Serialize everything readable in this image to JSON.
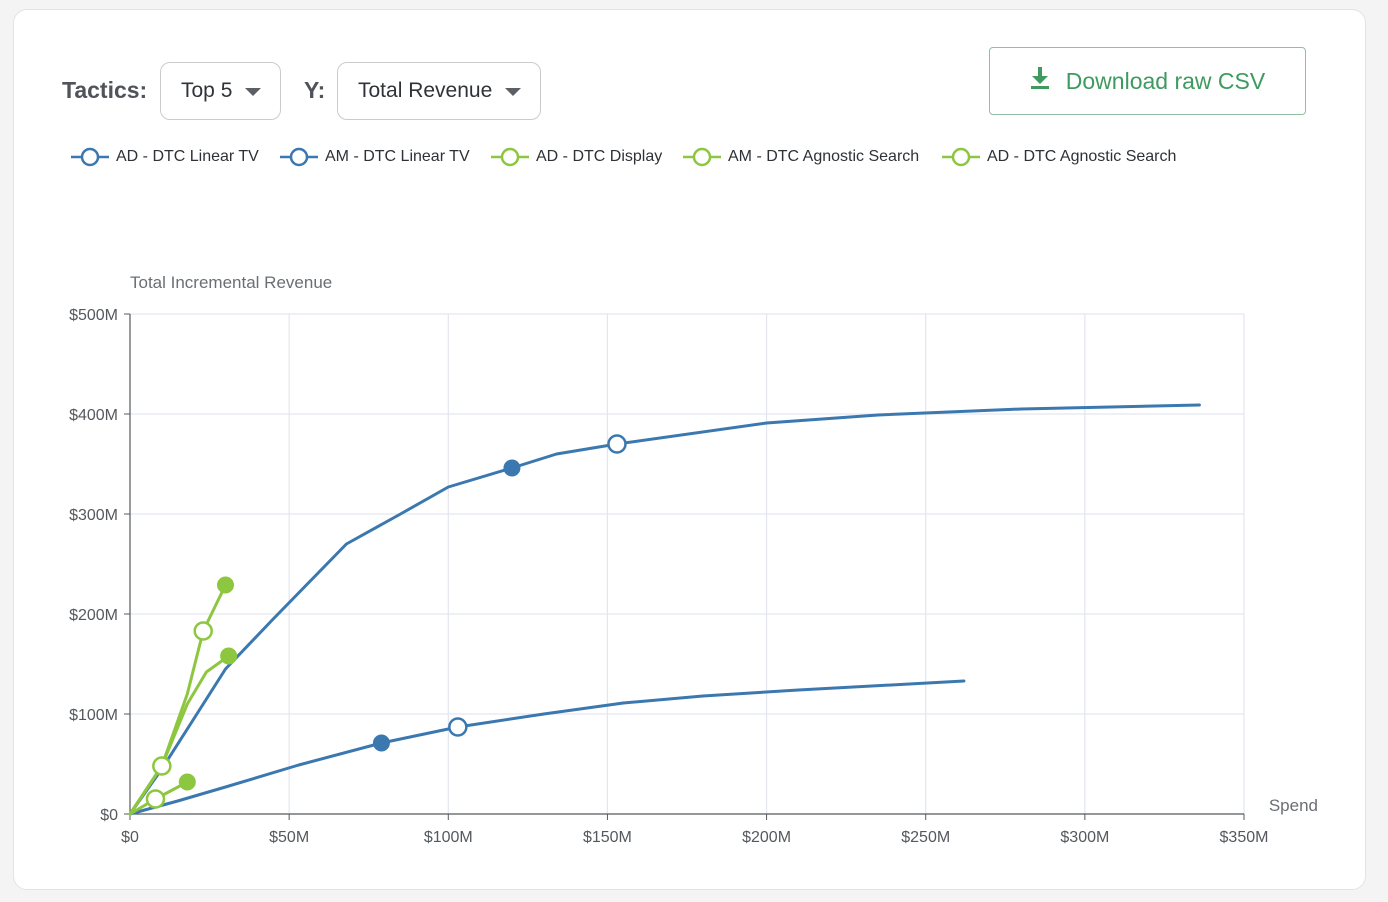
{
  "controls": {
    "tactics_label": "Tactics:",
    "tactics_value": "Top 5",
    "y_label": "Y:",
    "y_value": "Total Revenue",
    "download_label": "Download raw CSV"
  },
  "colors": {
    "blue": "#3b78b0",
    "green": "#8dc63f",
    "accent_green": "#3e9a5f"
  },
  "chart_data": {
    "type": "line",
    "ylabel": "Total Incremental Revenue",
    "xlabel": "Spend",
    "xlim": [
      0,
      350
    ],
    "ylim": [
      0,
      500
    ],
    "x_ticks": [
      "$0",
      "$50M",
      "$100M",
      "$150M",
      "$200M",
      "$250M",
      "$300M",
      "$350M"
    ],
    "y_ticks": [
      "$0",
      "$100M",
      "$200M",
      "$300M",
      "$400M",
      "$500M"
    ],
    "x_tick_values": [
      0,
      50,
      100,
      150,
      200,
      250,
      300,
      350
    ],
    "y_tick_values": [
      0,
      100,
      200,
      300,
      400,
      500
    ],
    "grid": true,
    "legend_position": "top-left",
    "series": [
      {
        "name": "AD - DTC Linear TV",
        "color": "#3b78b0",
        "points": [
          [
            0,
            0
          ],
          [
            10,
            45
          ],
          [
            20,
            95
          ],
          [
            30,
            145
          ],
          [
            45,
            195
          ],
          [
            68,
            270
          ],
          [
            85,
            300
          ],
          [
            100,
            327
          ],
          [
            120,
            346
          ],
          [
            134,
            360
          ],
          [
            153,
            370
          ],
          [
            200,
            391
          ],
          [
            235,
            399
          ],
          [
            280,
            405
          ],
          [
            336,
            409
          ]
        ],
        "filled_marker": [
          120,
          346
        ],
        "open_marker": [
          153,
          370
        ]
      },
      {
        "name": "AM - DTC Linear TV",
        "color": "#3b78b0",
        "points": [
          [
            0,
            0
          ],
          [
            15,
            13
          ],
          [
            30,
            27
          ],
          [
            53,
            49
          ],
          [
            79,
            71
          ],
          [
            103,
            87
          ],
          [
            130,
            100
          ],
          [
            155,
            111
          ],
          [
            180,
            118
          ],
          [
            210,
            124
          ],
          [
            262,
            133
          ]
        ],
        "filled_marker": [
          79,
          71
        ],
        "open_marker": [
          103,
          87
        ]
      },
      {
        "name": "AD - DTC Display",
        "color": "#8dc63f",
        "points": [
          [
            0,
            0
          ],
          [
            10,
            48
          ],
          [
            18,
            120
          ],
          [
            23,
            183
          ],
          [
            30,
            229
          ]
        ],
        "filled_marker": [
          30,
          229
        ],
        "open_marker": [
          23,
          183
        ]
      },
      {
        "name": "AM - DTC Agnostic Search",
        "color": "#8dc63f",
        "points": [
          [
            0,
            0
          ],
          [
            8,
            15
          ],
          [
            18,
            32
          ]
        ],
        "filled_marker": [
          18,
          32
        ],
        "open_marker": [
          8,
          15
        ]
      },
      {
        "name": "AD - DTC Agnostic Search",
        "color": "#8dc63f",
        "points": [
          [
            0,
            0
          ],
          [
            10,
            48
          ],
          [
            18,
            110
          ],
          [
            24,
            142
          ],
          [
            31,
            158
          ]
        ],
        "filled_marker": [
          31,
          158
        ],
        "open_marker": [
          10,
          48
        ]
      }
    ]
  }
}
